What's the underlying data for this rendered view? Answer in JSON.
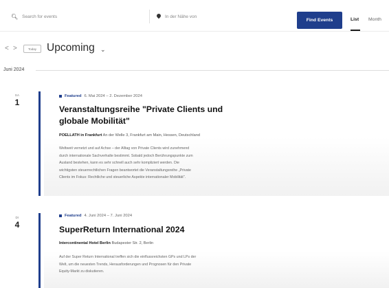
{
  "search": {
    "keyword_placeholder": "Search for events",
    "location_placeholder": "In der Nähe von",
    "find_button": "Find Events",
    "views": {
      "list": "List",
      "month": "Month"
    }
  },
  "toolbar": {
    "prev": "<",
    "next": ">",
    "today": "Today",
    "range_label": "Upcoming",
    "chevron": "⌄"
  },
  "month_separator": "Juni 2024",
  "events": [
    {
      "dow": "SA",
      "day": "1",
      "featured": "Featured",
      "dates": "6. Mai 2024 – 2. Dezember 2024",
      "title_line1": "Veranstaltungsreihe \"Private Clients und",
      "title_line2": "globale Mobilität\"",
      "venue_name": "POELLATH in Frankfurt",
      "venue_address": "An der Welle 3, Frankfurt am Main, Hessen, Deutschland",
      "description": [
        "Weltweit vernetzt und auf Achse – der Alltag von Private Clients wird zunehmend",
        "durch internationale Sachverhalte bestimmt. Sobald jedoch Berührungspunkte zum",
        "Ausland bestehen, kann es sehr schnell auch sehr kompliziert werden. Die",
        "wichtigsten steuerrechtlichen Fragen beantwortet die Veranstaltungsreihe „Private",
        "Clients im Fokus: Rechtliche und steuerliche Aspekte internationaler Mobilität\"."
      ]
    },
    {
      "dow": "DI",
      "day": "4",
      "featured": "Featured",
      "dates": "4. Juni 2024 – 7. Juni 2024",
      "title_line1": "SuperReturn International 2024",
      "venue_name": "Intercontinental Hotel Berlin",
      "venue_address": "Budapester Str. 2, Berlin",
      "description": [
        "Auf der Super Return International treffen sich die einflussreichsten GPs und LPs der",
        "Welt, um die neuesten Trends, Herausforderungen und Prognosen für den Private",
        "Equity-Markt zu diskutieren."
      ]
    }
  ],
  "colors": {
    "accent": "#1f3e8c"
  }
}
